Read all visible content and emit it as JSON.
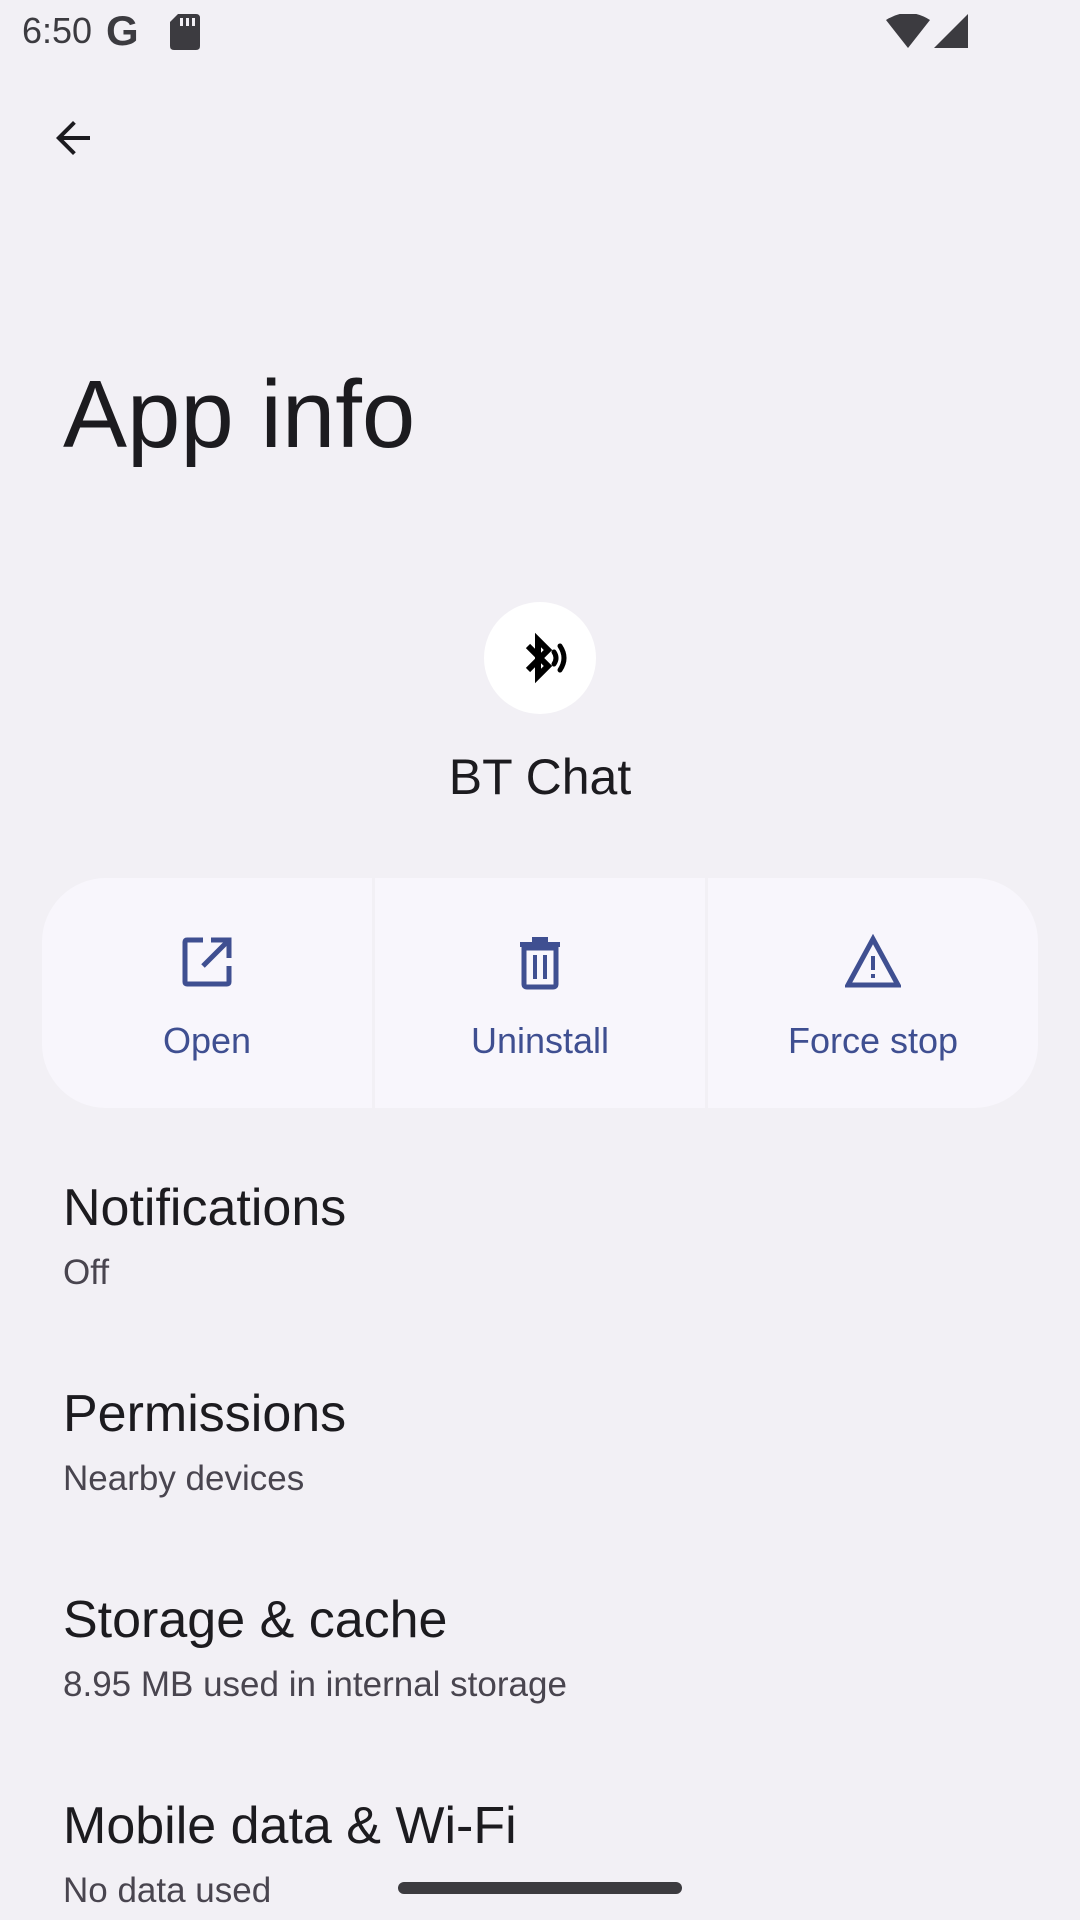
{
  "status_bar": {
    "time": "6:50",
    "google_glyph": "G",
    "icons": [
      "google-icon",
      "sd-card-icon",
      "wifi-icon",
      "signal-icon"
    ]
  },
  "header": {
    "back_icon": "arrow-back-icon",
    "title": "App info"
  },
  "app": {
    "icon": "bluetooth-audio-icon",
    "name": "BT Chat"
  },
  "actions": [
    {
      "label": "Open",
      "icon": "open-external-icon"
    },
    {
      "label": "Uninstall",
      "icon": "trash-icon"
    },
    {
      "label": "Force stop",
      "icon": "warning-icon"
    }
  ],
  "preferences": [
    {
      "title": "Notifications",
      "summary": "Off"
    },
    {
      "title": "Permissions",
      "summary": "Nearby devices"
    },
    {
      "title": "Storage & cache",
      "summary": "8.95 MB used in internal storage"
    },
    {
      "title": "Mobile data & Wi-Fi",
      "summary": "No data used"
    }
  ],
  "colors": {
    "background": "#f2f0f5",
    "accent": "#3f4f91",
    "action_surface": "#f8f6fc",
    "text_primary": "#1c1b1f",
    "text_secondary": "#49454f"
  }
}
